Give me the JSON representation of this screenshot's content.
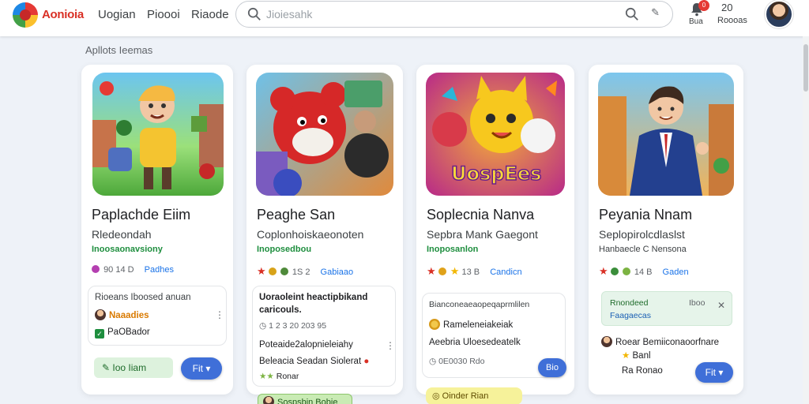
{
  "header": {
    "brand": "Aonioia",
    "nav": [
      "Uogian",
      "Pioooi",
      "Riaode"
    ],
    "search_placeholder": "Jioiesahk",
    "notif_badge": "0",
    "notif_label": "Bua",
    "count": "20",
    "count_label": "Roooas"
  },
  "section_title": "Apllots Ieemas",
  "cards": [
    {
      "title": "Paplachde Eiim",
      "subtitle": "Rledeondah",
      "tag": "Inoosaonavsiony",
      "rating_text": "90 14 D",
      "rating_link": "Padhes",
      "row1": "Rioeans Iboosed anuan",
      "row2": "Naaadies",
      "row3": "PaOBador",
      "button_green": "Ioo Iiam",
      "button_blue": "Fit"
    },
    {
      "title": "Peaghe San",
      "subtitle": "Coplonhoiskaeonoten",
      "tag": "Inoposedbou",
      "rating_text": "1S 2",
      "rating_link": "Gabiaao",
      "row1": "Uoraoleint heactipbikand",
      "row1b": "caricouls.",
      "row2": "1 2 3 20 203 95",
      "row3": "Poteaide2alopnieleiahy",
      "row4": "Beleacia Seadan Siolerat",
      "row5": "Ronar",
      "chip": "Sospsbin Bobie"
    },
    {
      "title": "Soplecnia Nanva",
      "subtitle": "Sepbra Mank Gaegont",
      "tag": "Inoposanlon",
      "rating_text": "13 B",
      "rating_link": "Candicn",
      "row1": "Bianconeaeaopeqaprmlilen",
      "row2": "Rameleneiakeiak",
      "row3": "Aeebria Uloesedeatelk",
      "row4": "0E0030 Rdo",
      "button_blue": "Bio",
      "chip": "Oinder Rian"
    },
    {
      "title": "Peyania Nnam",
      "subtitle": "Seplopirolcdlaslst",
      "tag": "Hanbaecle C Nensona",
      "rating_text": "14 B",
      "rating_link": "Gaden",
      "notice1": "Rnondeed",
      "notice2": "Faagaecas",
      "notice3": "Iboo",
      "row1": "Roear Bemiiconaoorfnare",
      "row2": "Banl",
      "row3": "Ra Ronao",
      "button_blue": "Fit"
    }
  ],
  "colors": {
    "accent": "#3f6fd8",
    "brand": "#d93025",
    "tag": "#1e8e3e",
    "background": "#eef2f8"
  }
}
